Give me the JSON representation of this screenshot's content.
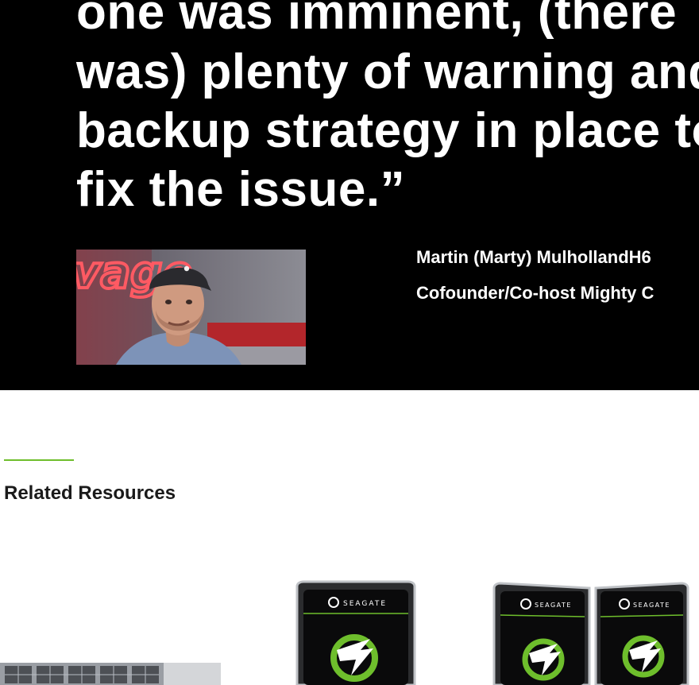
{
  "quote": {
    "lines": [
      "one was imminent, (there",
      "was) plenty of warning and",
      "backup strategy in place to",
      "fix the issue.”"
    ]
  },
  "person": {
    "name": "Martin (Marty) MulhollandH6",
    "role": "Cofounder/Co-host Mighty C",
    "photo_sign_text": "vage"
  },
  "related": {
    "heading": "Related Resources",
    "accent_color": "#6ebe2c",
    "items": [
      {
        "image": "nas-rackmount-image"
      },
      {
        "image": "hard-drive-image",
        "brand": "SEAGATE"
      },
      {
        "image": "hard-drive-pair-image",
        "brand_left": "SEAGATE",
        "brand_right": "SEAGATE"
      }
    ]
  }
}
